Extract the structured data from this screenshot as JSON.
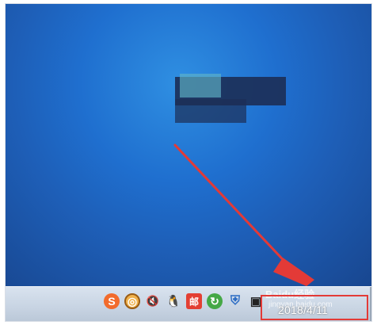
{
  "taskbar": {
    "date": "2018/4/11",
    "watermark_main": "Baidu经验",
    "watermark_sub": "jingyan.baidu.com"
  },
  "tray": {
    "icons": [
      "sogou-input-icon",
      "game-icon",
      "volume-muted-icon",
      "qq-icon",
      "mail-icon",
      "refresh-icon",
      "security-shield-icon",
      "network-icon"
    ]
  },
  "colors": {
    "desktop_blue": "#1f6fcf",
    "laser_red": "#e33a37",
    "taskbar": "#c7d3e2"
  }
}
